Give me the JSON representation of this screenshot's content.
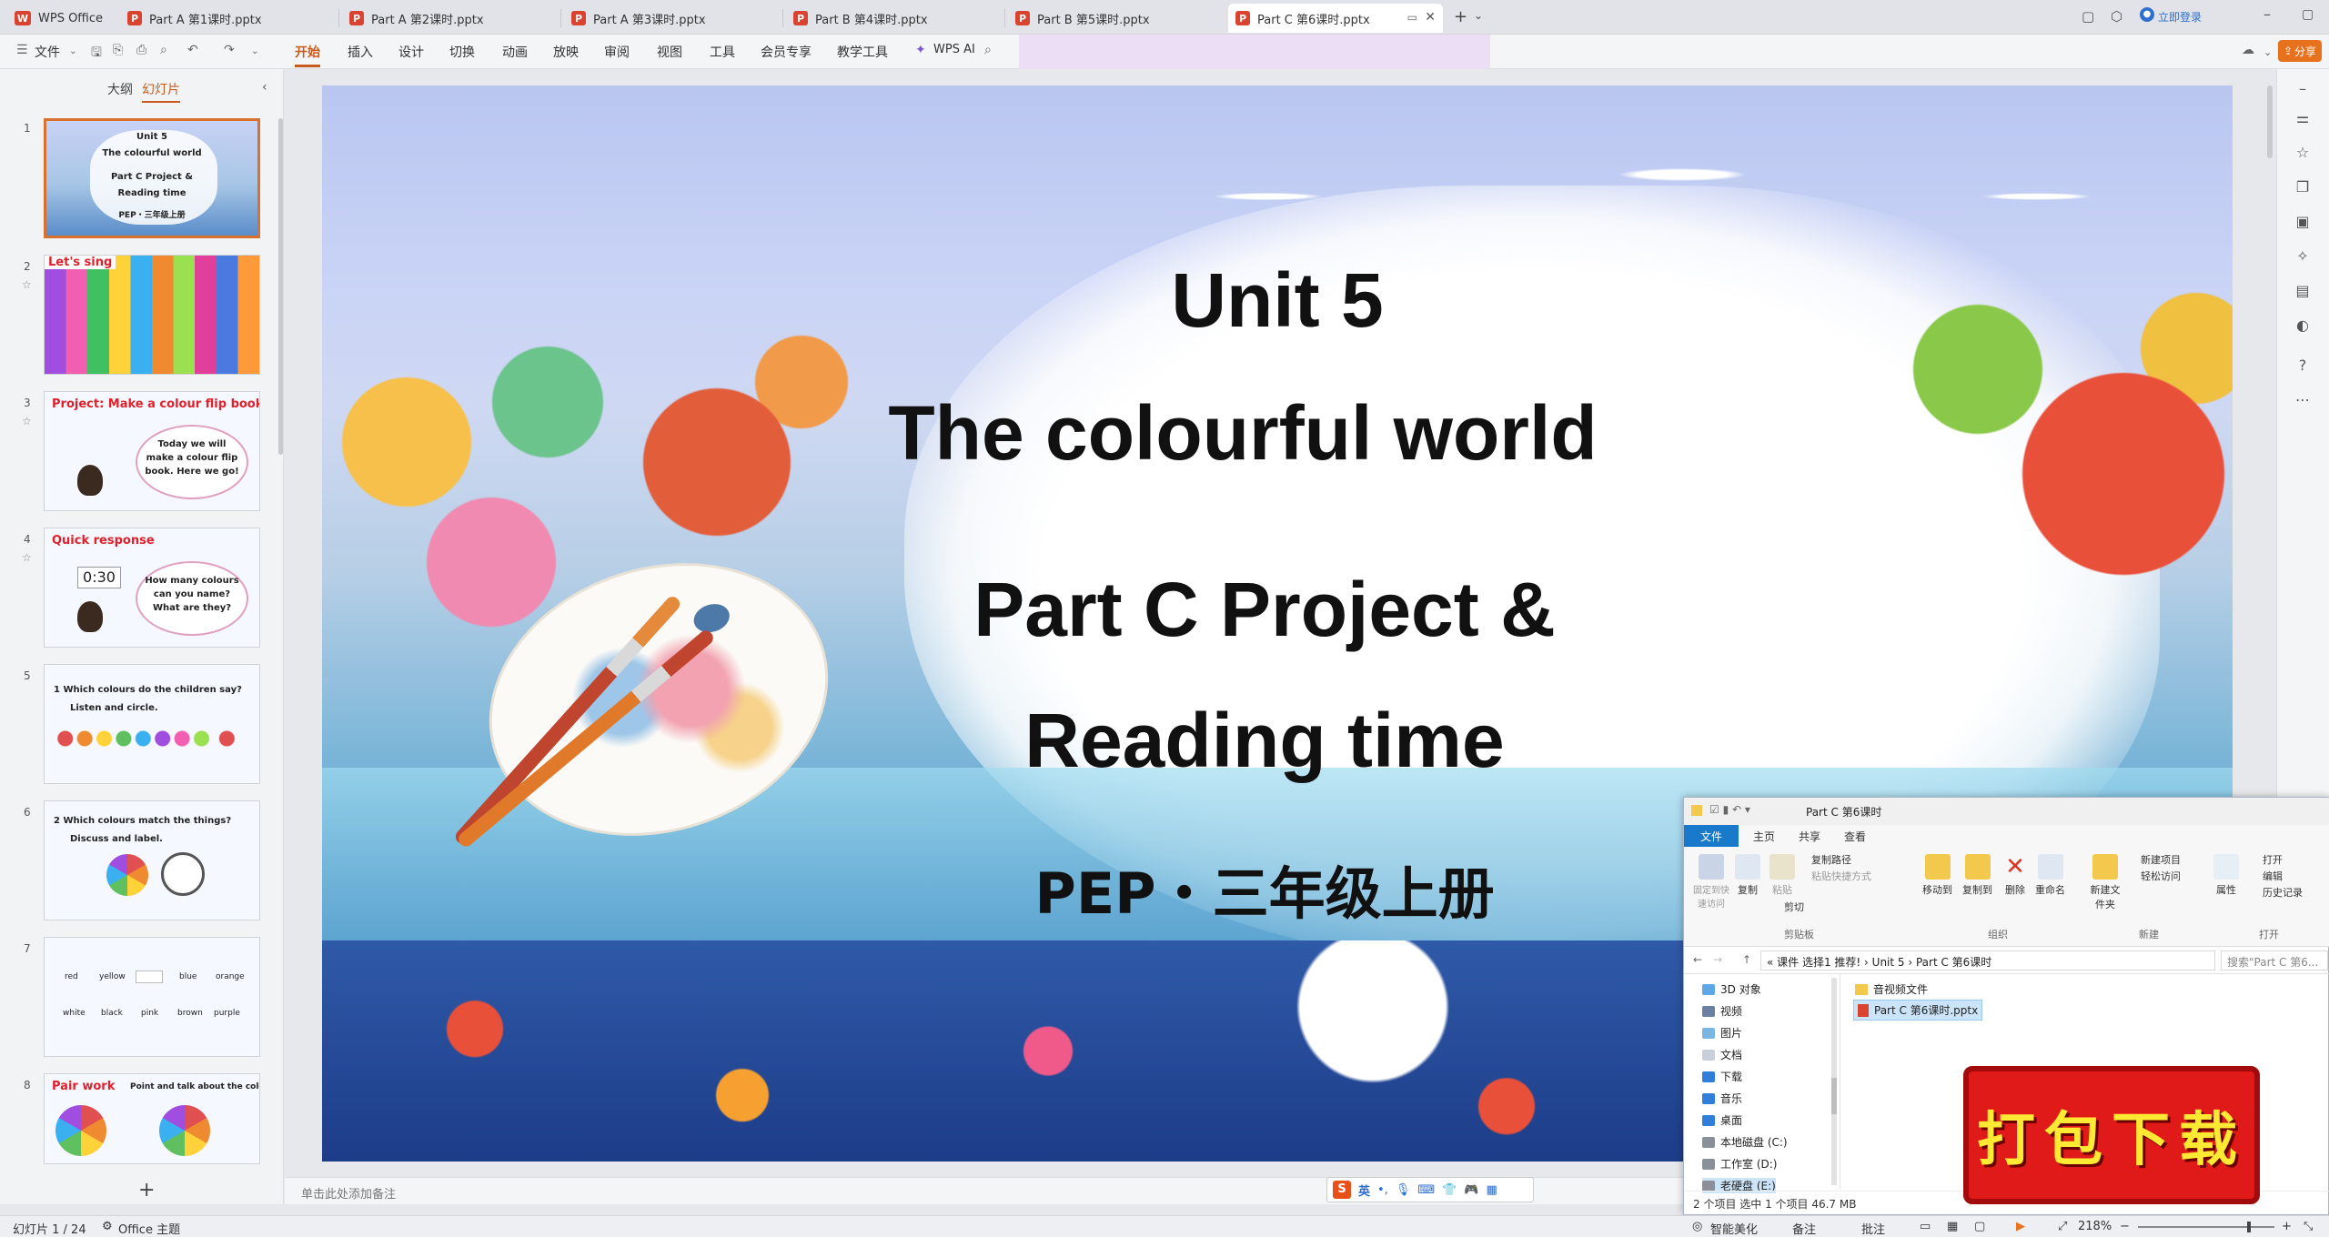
{
  "tabs": [
    {
      "label": "WPS Office",
      "type": "wps"
    },
    {
      "label": "Part A 第1课时.pptx",
      "type": "ppt"
    },
    {
      "label": "Part A 第2课时.pptx",
      "type": "ppt"
    },
    {
      "label": "Part A 第3课时.pptx",
      "type": "ppt"
    },
    {
      "label": "Part B 第4课时.pptx",
      "type": "ppt"
    },
    {
      "label": "Part B 第5课时.pptx",
      "type": "ppt"
    },
    {
      "label": "Part C 第6课时.pptx",
      "type": "ppt"
    }
  ],
  "titlebar": {
    "login": "立即登录",
    "share": "分享"
  },
  "ribbon": {
    "file": "文件",
    "items": [
      "开始",
      "插入",
      "设计",
      "切换",
      "动画",
      "放映",
      "审阅",
      "视图",
      "工具",
      "会员专享",
      "教学工具"
    ],
    "wps_ai": "WPS AI"
  },
  "panel": {
    "tab_outline": "大纲",
    "tab_slides": "幻灯片"
  },
  "thumbs": [
    {
      "num": "1",
      "lines": [
        "Unit 5",
        "The colourful world",
        "Part C Project &",
        "Reading time",
        "PEP・三年级上册"
      ]
    },
    {
      "num": "2",
      "title": "Let's sing"
    },
    {
      "num": "3",
      "title": "Project: Make a colour flip book",
      "bubble": "Today we will make a colour flip book. Here we go!"
    },
    {
      "num": "4",
      "title": "Quick response",
      "timer": "0:30",
      "bubble": "How many colours can you name? What are they?"
    },
    {
      "num": "5",
      "title": "1  Which colours do the children say?",
      "sub": "Listen and circle."
    },
    {
      "num": "6",
      "title": "2  Which colours match the things?",
      "sub": "Discuss and label."
    },
    {
      "num": "7",
      "words": [
        "red",
        "yellow",
        "",
        "blue",
        "orange",
        "white",
        "black",
        "pink",
        "brown",
        "purple"
      ]
    },
    {
      "num": "8",
      "title": "Pair work",
      "sub": "Point and talk about the colour."
    }
  ],
  "slide": {
    "line1": "Unit 5",
    "line2": "The colourful world",
    "line3": "Part C Project &",
    "line4": "Reading time",
    "line5": "PEP・三年级上册"
  },
  "notes": "单击此处添加备注",
  "status": {
    "slide_pos": "幻灯片 1 / 24",
    "theme": "Office 主题",
    "smart": "智能美化",
    "notes_btn": "备注",
    "comment": "批注",
    "zoom": "218%"
  },
  "explorer": {
    "title": "Part C 第6课时",
    "tabs": [
      "文件",
      "主页",
      "共享",
      "查看"
    ],
    "buttons": [
      "固定到快速访问",
      "复制",
      "粘贴",
      "复制路径",
      "粘贴快捷方式",
      "剪切",
      "移动到",
      "复制到",
      "删除",
      "重命名",
      "新建文件夹",
      "新建项目",
      "轻松访问",
      "属性",
      "打开",
      "编辑",
      "历史记录"
    ],
    "groups": [
      "剪贴板",
      "组织",
      "新建",
      "打开"
    ],
    "path": "« 课件 选择1 推荐! › Unit 5 › Part C 第6课时",
    "search": "搜索\"Part C 第6...",
    "nav": [
      "3D 对象",
      "视频",
      "图片",
      "文档",
      "下载",
      "音乐",
      "桌面",
      "本地磁盘 (C:)",
      "工作室 (D:)",
      "老硬盘 (E:)"
    ],
    "files": [
      "音视频文件",
      "Part C 第6课时.pptx"
    ],
    "status": "2 个项目   选中 1 个项目  46.7 MB"
  },
  "download_banner": "打包下载",
  "ime": "英"
}
